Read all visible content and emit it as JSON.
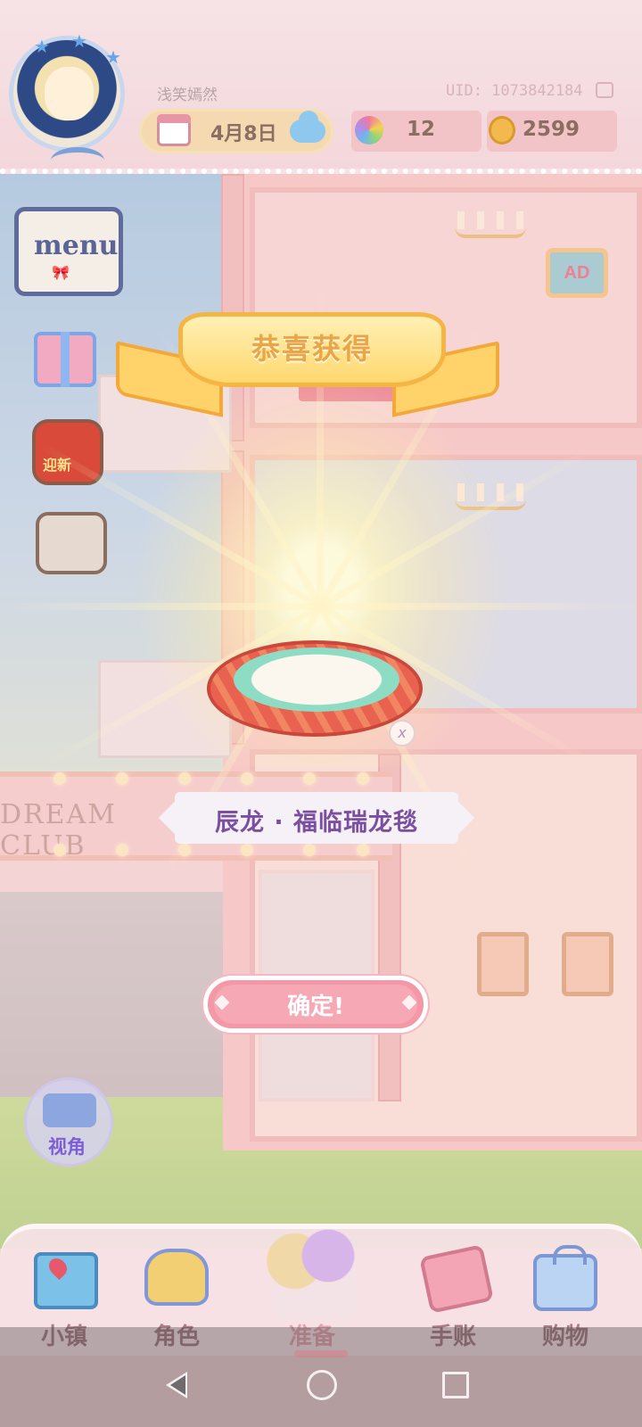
{
  "header": {
    "username": "浅笑嫣然",
    "uid_label": "UID: 1073842184",
    "date": "4月8日",
    "gems": "12",
    "coins": "2599"
  },
  "side": {
    "menu_label": "menu",
    "new_year_label": "迎新",
    "camera_label": "视角"
  },
  "scene": {
    "club_sign": "DREAM CLUB",
    "ad_sign": "AD"
  },
  "reward": {
    "title": "恭喜获得",
    "item_name": "辰龙 · 福临瑞龙毯",
    "close_label": "x",
    "confirm_label": "确定!"
  },
  "nav": {
    "items": [
      {
        "label": "小镇",
        "icon": "map-icon"
      },
      {
        "label": "角色",
        "icon": "character-icon"
      },
      {
        "label": "准备",
        "icon": "basket-icon"
      },
      {
        "label": "手账",
        "icon": "journal-icon"
      },
      {
        "label": "购物",
        "icon": "shopping-bag-icon"
      }
    ]
  },
  "colors": {
    "accent_pink": "#f497a7",
    "ribbon_gold": "#ffd86e",
    "item_text": "#7a4fa0"
  }
}
